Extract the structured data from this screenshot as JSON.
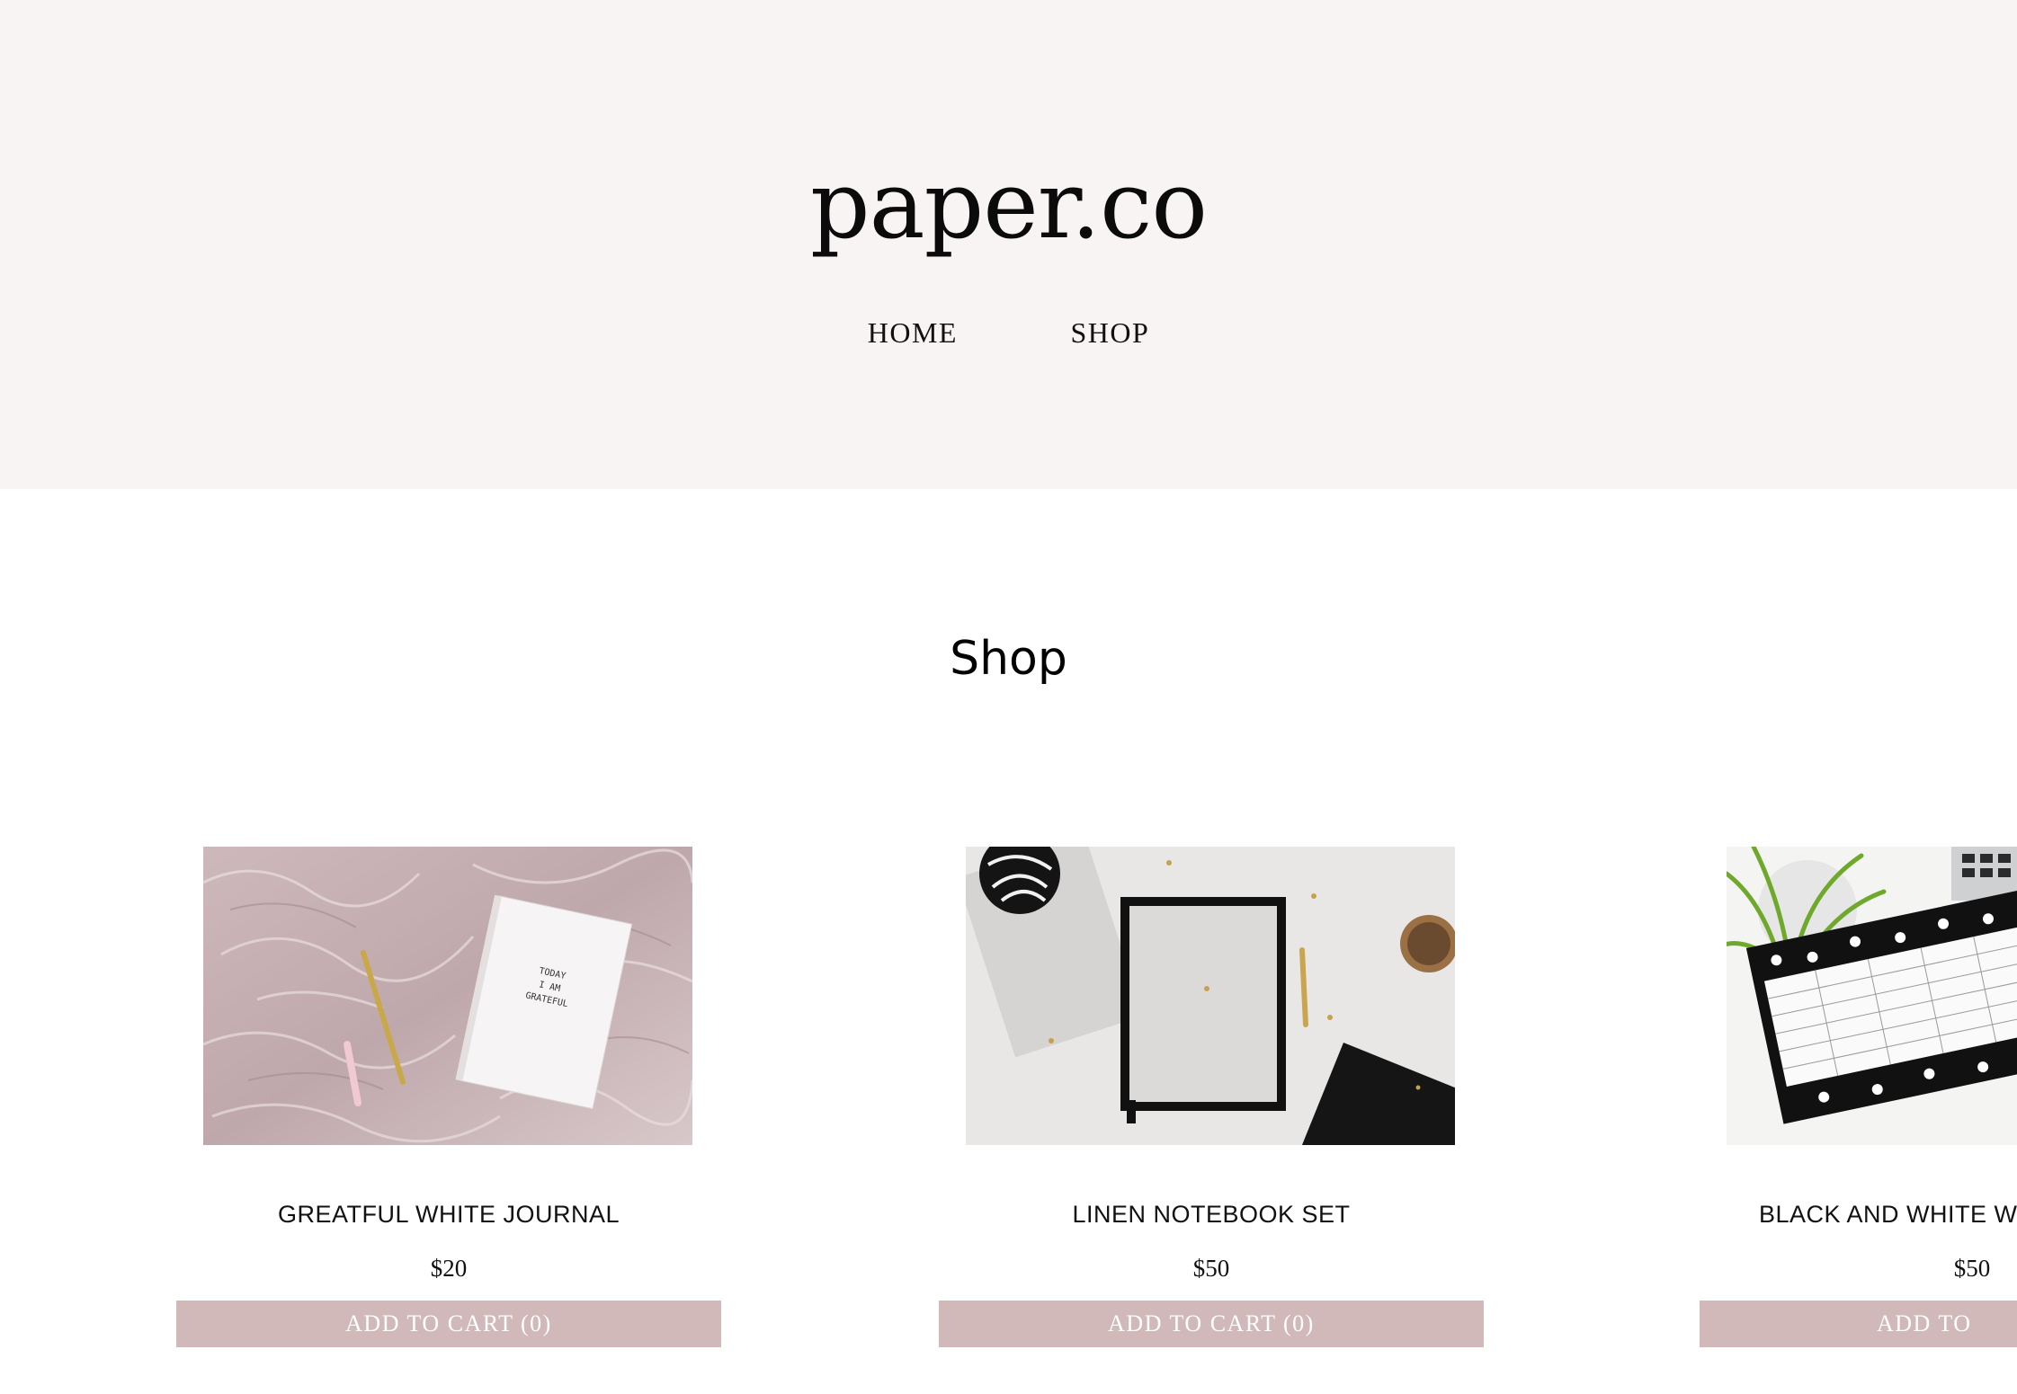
{
  "header": {
    "logo": "paper.co",
    "nav": {
      "home": "HOME",
      "shop": "SHOP"
    },
    "background": "#f9f4f4"
  },
  "main": {
    "title": "Shop",
    "products": [
      {
        "name": "GREATFUL WHITE JOURNAL",
        "price": "$20",
        "button": "ADD TO CART (0)",
        "image_text": "TODAY I AM GRATEFUL"
      },
      {
        "name": "LINEN NOTEBOOK SET",
        "price": "$50",
        "button": "ADD TO CART (0)"
      },
      {
        "name": "BLACK AND WHITE WE",
        "price": "$50",
        "button": "ADD TO CAR"
      }
    ],
    "button_color": "#d2b9b9"
  }
}
